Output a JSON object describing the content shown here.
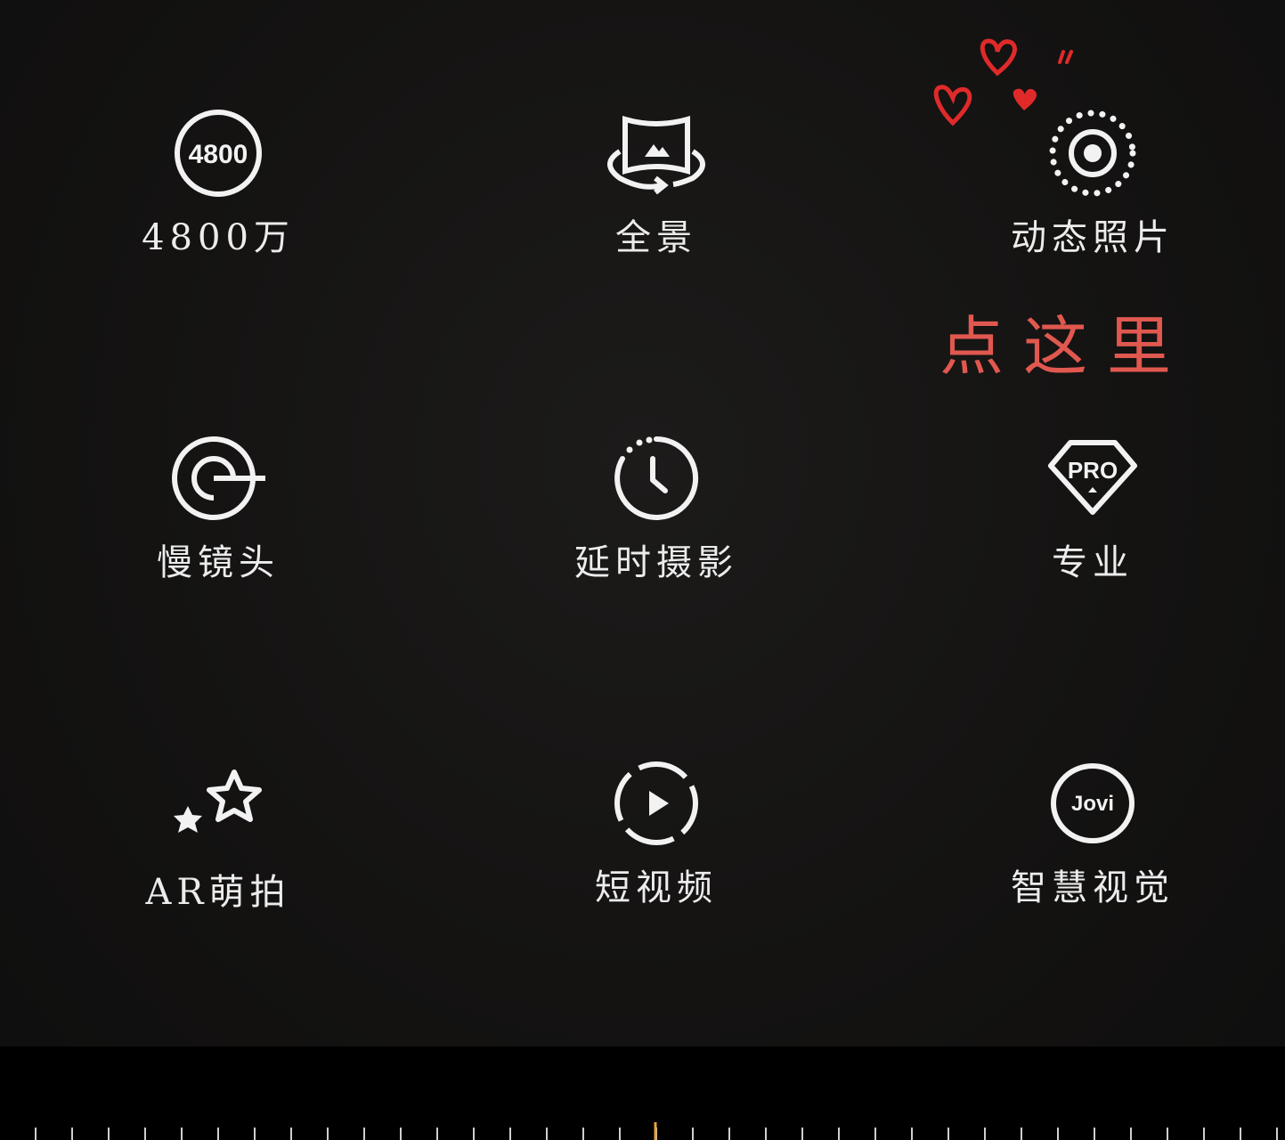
{
  "modes": [
    {
      "id": "48mp",
      "label": "4800万",
      "icon": "4800-circle-icon",
      "icon_text": "4800"
    },
    {
      "id": "panorama",
      "label": "全景",
      "icon": "panorama-icon"
    },
    {
      "id": "motion",
      "label": "动态照片",
      "icon": "live-photo-icon"
    },
    {
      "id": "slowmo",
      "label": "慢镜头",
      "icon": "slow-motion-icon"
    },
    {
      "id": "timelapse",
      "label": "延时摄影",
      "icon": "timelapse-icon"
    },
    {
      "id": "pro",
      "label": "专业",
      "icon": "pro-icon",
      "icon_text": "PRO"
    },
    {
      "id": "ar",
      "label": "AR萌拍",
      "icon": "ar-stars-icon"
    },
    {
      "id": "shortvideo",
      "label": "短视频",
      "icon": "short-video-icon"
    },
    {
      "id": "jovi",
      "label": "智慧视觉",
      "icon": "jovi-icon",
      "icon_text": "Jovi"
    }
  ],
  "annotation": {
    "text": "点这里",
    "color": "#e0584f",
    "hearts_color": "#e02a2a"
  },
  "colors": {
    "icon": "#f2f2f2",
    "background": "#151413",
    "bar": "#000000",
    "tick_accent": "#e6a23c"
  }
}
